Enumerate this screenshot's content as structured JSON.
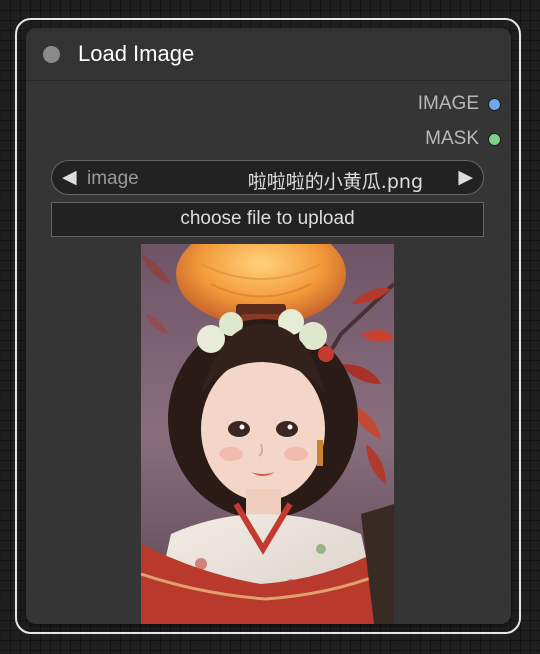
{
  "node": {
    "title": "Load Image",
    "outputs": [
      {
        "label": "IMAGE",
        "color": "#6ea6f0"
      },
      {
        "label": "MASK",
        "color": "#7ed18a"
      }
    ],
    "image_widget": {
      "name": "image",
      "value": "啦啦啦的小黄瓜.png",
      "prev_arrow": "◀",
      "next_arrow": "▶"
    },
    "upload_button_label": "choose file to upload",
    "preview": {
      "subject": "girl-in-hanfu-with-lantern",
      "icon": "image-preview"
    }
  },
  "colors": {
    "canvas_bg": "#1f1f1f",
    "node_bg": "#353535",
    "widget_bg": "#222222",
    "title_text": "#ffffff",
    "selection_outline": "#e6e6e6"
  }
}
